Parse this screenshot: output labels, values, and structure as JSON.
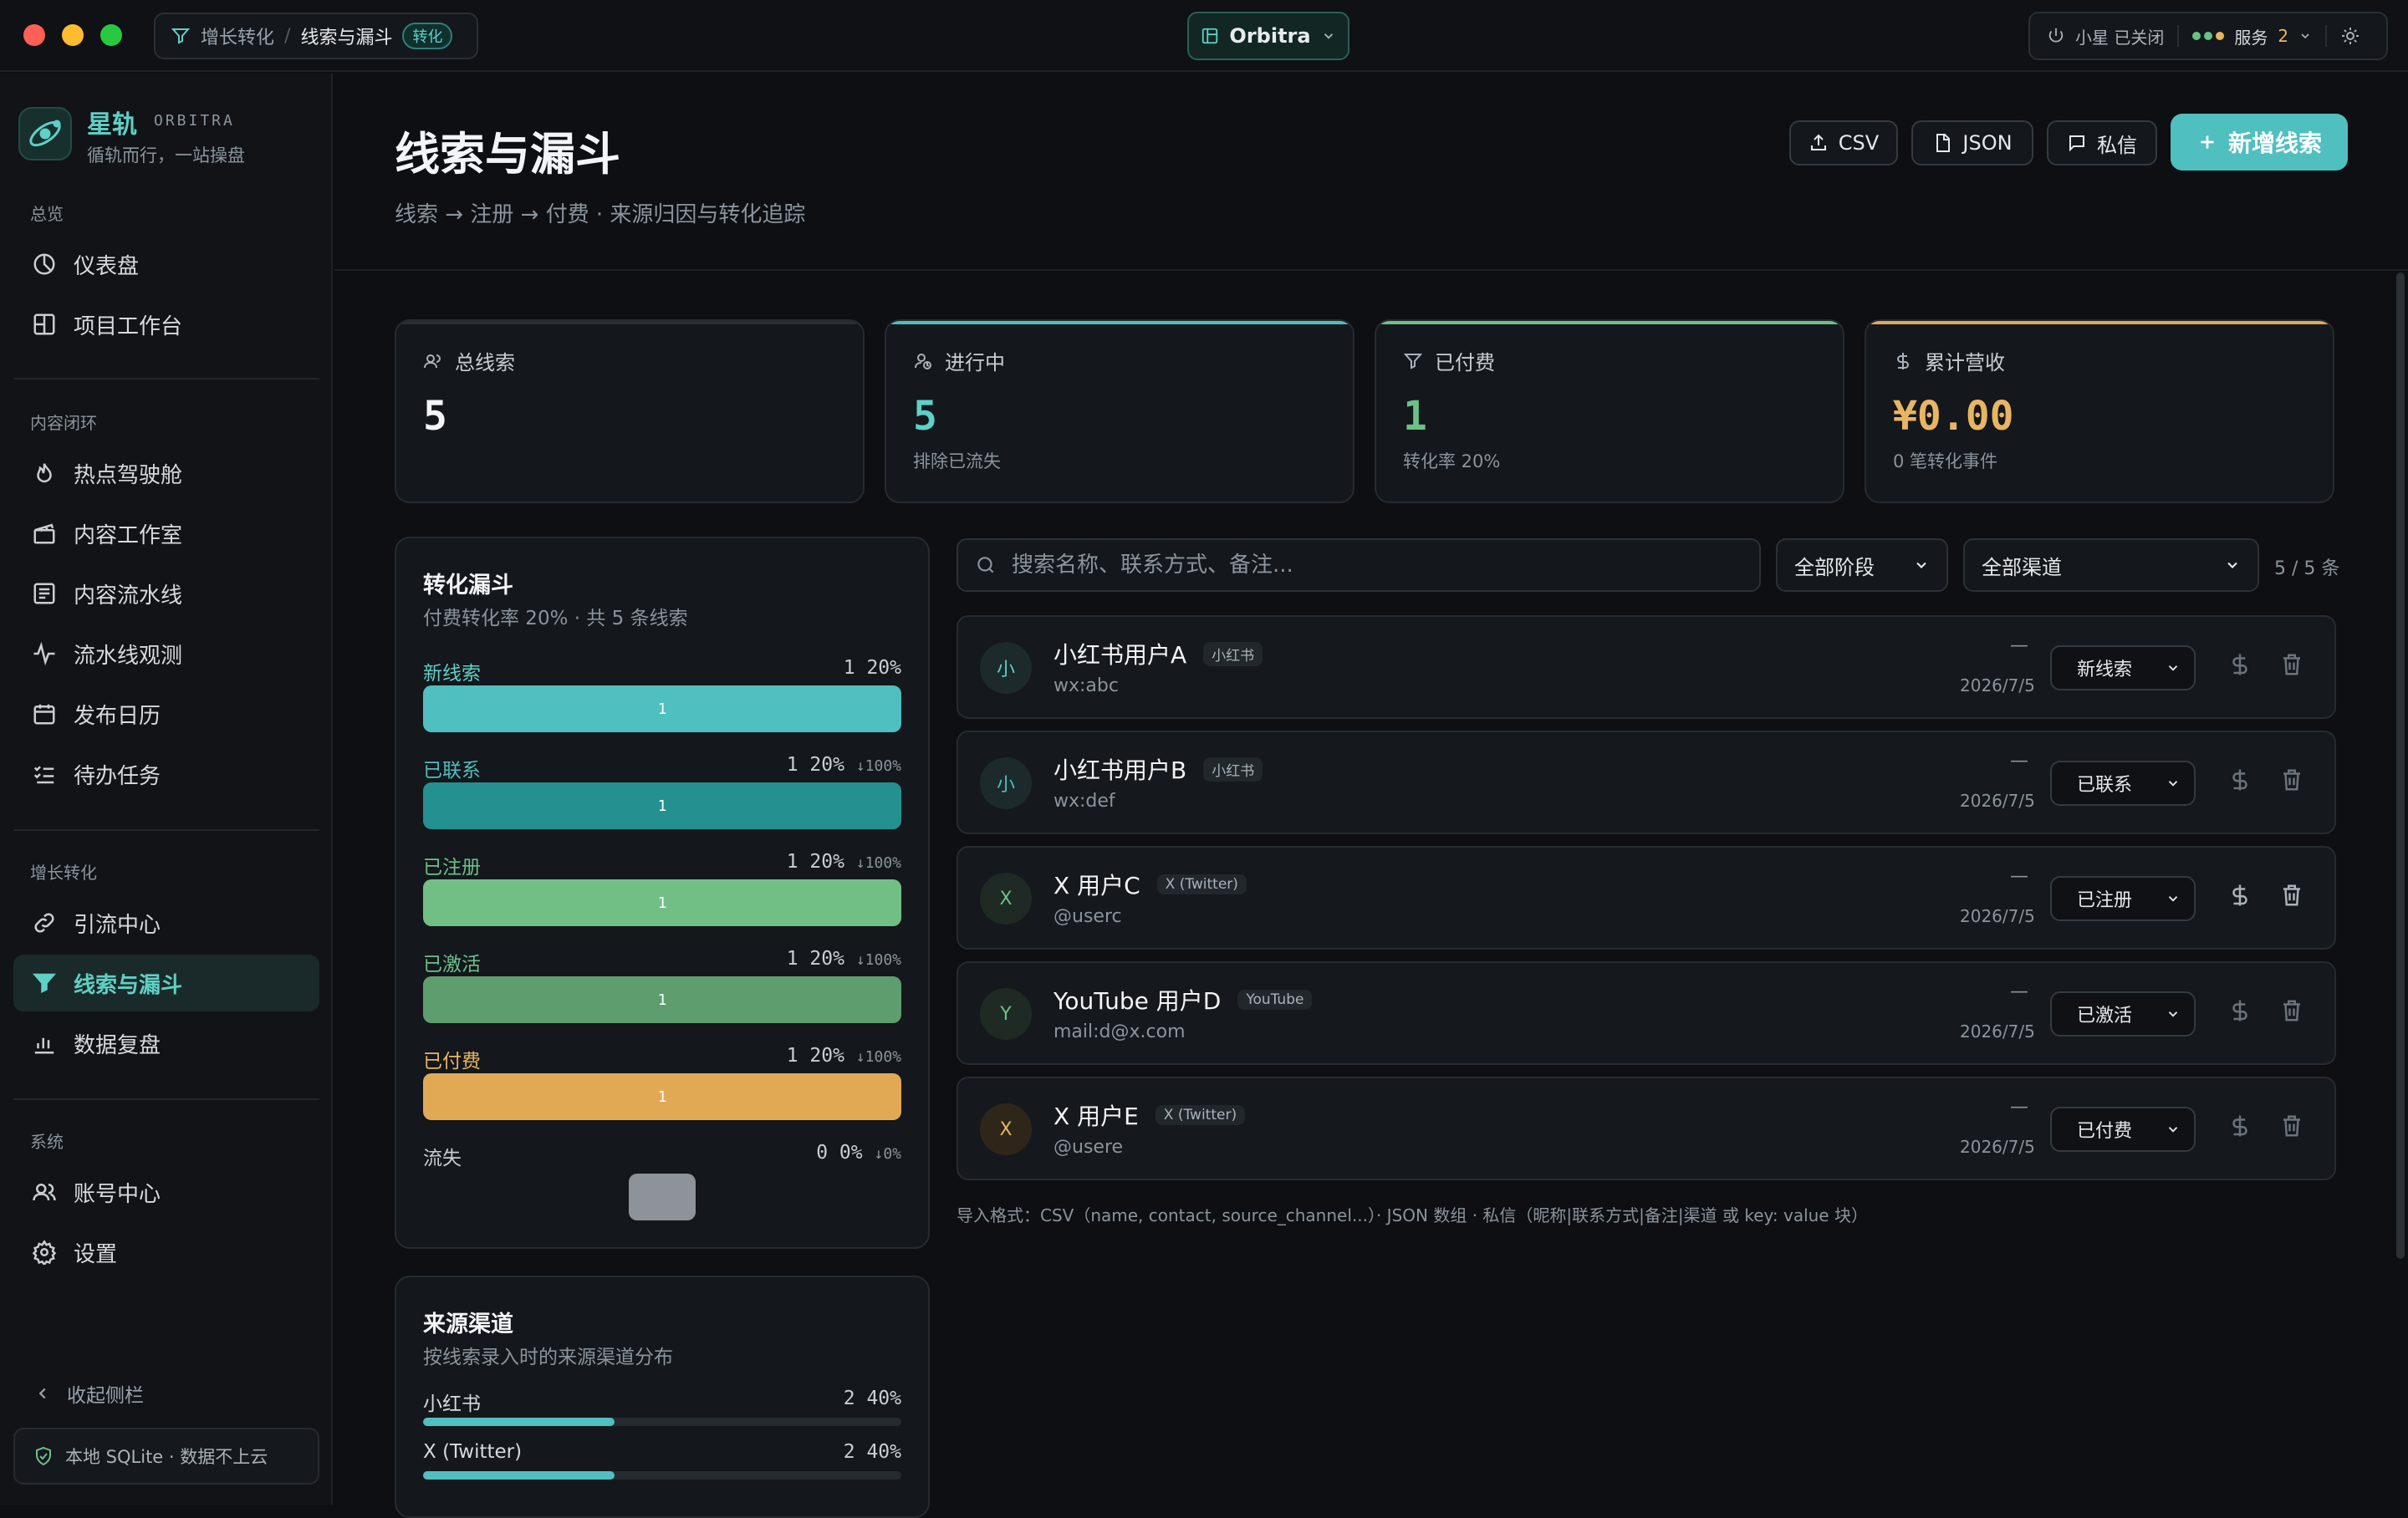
{
  "titlebar": {
    "breadcrumb_parent": "增长转化",
    "breadcrumb_sep": "/",
    "breadcrumb_current": "线索与漏斗",
    "breadcrumb_badge": "转化",
    "workspace": "Orbitra",
    "assistant_status": "小星 已关闭",
    "services_label": "服务",
    "services_count": "2"
  },
  "brand": {
    "name": "星轨",
    "en": "ORBITRA",
    "tagline": "循轨而行，一站操盘"
  },
  "sidebar": {
    "sections": [
      "总览",
      "内容闭环",
      "增长转化",
      "系统"
    ],
    "items": [
      "仪表盘",
      "项目工作台",
      "热点驾驶舱",
      "内容工作室",
      "内容流水线",
      "流水线观测",
      "发布日历",
      "待办任务",
      "引流中心",
      "线索与漏斗",
      "数据复盘",
      "账号中心",
      "设置"
    ],
    "collapse": "收起侧栏",
    "storage": "本地 SQLite · 数据不上云"
  },
  "page": {
    "title": "线索与漏斗",
    "subtitle": "线索 → 注册 → 付费 · 来源归因与转化追踪",
    "buttons": {
      "csv": "CSV",
      "json": "JSON",
      "dm": "私信",
      "add": "新增线索"
    }
  },
  "stats": [
    {
      "label": "总线索",
      "value": "5",
      "sub": "",
      "accent": "#2a2f35",
      "color": "#f2f4f6"
    },
    {
      "label": "进行中",
      "value": "5",
      "sub": "排除已流失",
      "accent": "#4fbfbf",
      "color": "#5fd0c6"
    },
    {
      "label": "已付费",
      "value": "1",
      "sub": "转化率 20%",
      "accent": "#6cc08a",
      "color": "#6cc08a"
    },
    {
      "label": "累计营收",
      "value": "¥0.00",
      "sub": "0 笔转化事件",
      "accent": "#e0a95a",
      "color": "#e8b563"
    }
  ],
  "funnel": {
    "title": "转化漏斗",
    "subtitle": "付费转化率 20% · 共 5 条线索",
    "rows": [
      {
        "name": "新线索",
        "count": "1",
        "pct": "20%",
        "drop": "",
        "bar_label": "1",
        "color": "#4fbfbf",
        "name_color": "#5fd0c6"
      },
      {
        "name": "已联系",
        "count": "1",
        "pct": "20%",
        "drop": "↓100%",
        "bar_label": "1",
        "color": "#249090",
        "name_color": "#4fbfbf"
      },
      {
        "name": "已注册",
        "count": "1",
        "pct": "20%",
        "drop": "↓100%",
        "bar_label": "1",
        "color": "#72bf86",
        "name_color": "#6cc08a"
      },
      {
        "name": "已激活",
        "count": "1",
        "pct": "20%",
        "drop": "↓100%",
        "bar_label": "1",
        "color": "#5e9e6e",
        "name_color": "#6cc08a"
      },
      {
        "name": "已付费",
        "count": "1",
        "pct": "20%",
        "drop": "↓100%",
        "bar_label": "1",
        "color": "#e2a955",
        "name_color": "#e8b563"
      }
    ],
    "lost": {
      "name": "流失",
      "count": "0",
      "pct": "0%",
      "drop": "↓0%"
    }
  },
  "sources": {
    "title": "来源渠道",
    "subtitle": "按线索录入时的来源渠道分布",
    "rows": [
      {
        "name": "小红书",
        "count": "2",
        "pct": "40%",
        "fraction": 0.4
      },
      {
        "name": "X (Twitter)",
        "count": "2",
        "pct": "40%",
        "fraction": 0.4
      }
    ]
  },
  "filters": {
    "search_placeholder": "搜索名称、联系方式、备注...",
    "stage": "全部阶段",
    "channel": "全部渠道",
    "count": "5 / 5 条"
  },
  "leads": [
    {
      "initial": "小",
      "name": "小红书用户A",
      "channel": "小红书",
      "contact": "wx:abc",
      "dash": "—",
      "date": "2026/7/5",
      "stage": "新线索",
      "avatar_color": "#5fd0c6",
      "avatar_bg": "#1c2a2c"
    },
    {
      "initial": "小",
      "name": "小红书用户B",
      "channel": "小红书",
      "contact": "wx:def",
      "dash": "—",
      "date": "2026/7/5",
      "stage": "已联系",
      "avatar_color": "#4fbfbf",
      "avatar_bg": "#1c2a2c"
    },
    {
      "initial": "X",
      "name": "X 用户C",
      "channel": "X (Twitter)",
      "contact": "@userc",
      "dash": "—",
      "date": "2026/7/5",
      "stage": "已注册",
      "avatar_color": "#6cc08a",
      "avatar_bg": "#1e2a23"
    },
    {
      "initial": "Y",
      "name": "YouTube 用户D",
      "channel": "YouTube",
      "contact": "mail:d@x.com",
      "dash": "—",
      "date": "2026/7/5",
      "stage": "已激活",
      "avatar_color": "#6cc08a",
      "avatar_bg": "#1e2a23"
    },
    {
      "initial": "X",
      "name": "X 用户E",
      "channel": "X (Twitter)",
      "contact": "@usere",
      "dash": "—",
      "date": "2026/7/5",
      "stage": "已付费",
      "avatar_color": "#e8b563",
      "avatar_bg": "#2e2719"
    }
  ],
  "import_note": "导入格式：CSV（name, contact, source_channel...）· JSON 数组 · 私信（昵称|联系方式|备注|渠道 或 key: value 块）"
}
